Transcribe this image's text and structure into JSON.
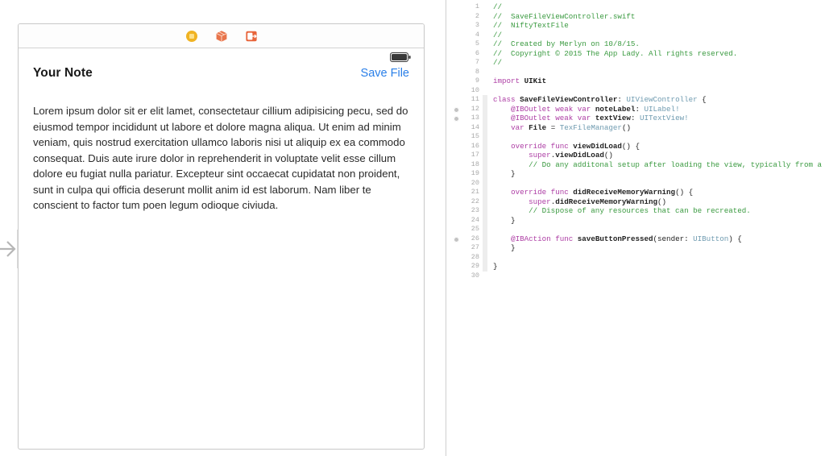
{
  "simulator": {
    "toolbar": {
      "icons": [
        {
          "name": "stop-recording-icon",
          "label": "Stop",
          "color": "#f0b323"
        },
        {
          "name": "package-cube-icon",
          "label": "Package",
          "color": "#e8744b"
        },
        {
          "name": "export-share-icon",
          "label": "Export",
          "color": "#e8643a"
        }
      ]
    },
    "status_bar": {
      "battery_icon": "battery-full-icon"
    },
    "header": {
      "title": "Your Note",
      "save_label": "Save File",
      "save_color": "#2a7fe8"
    },
    "note_body": "Lorem ipsum dolor sit er elit lamet, consectetaur cillium adipisicing pecu, sed do eiusmod tempor incididunt ut labore et dolore magna aliqua. Ut enim ad minim veniam, quis nostrud exercitation ullamco laboris nisi ut aliquip ex ea commodo consequat. Duis aute irure dolor in reprehenderit in voluptate velit esse cillum dolore eu fugiat nulla pariatur. Excepteur sint occaecat cupidatat non proident, sunt in culpa qui officia deserunt mollit anim id est laborum. Nam liber te conscient to factor tum poen legum odioque civiuda."
  },
  "navigation": {
    "back_arrow_icon": "arrow-right-icon"
  },
  "editor": {
    "filename": "SaveFileViewController.swift",
    "total_lines": 30,
    "breakpoint_lines": [
      12,
      13,
      26
    ],
    "lines": [
      {
        "n": 1,
        "tokens": [
          {
            "t": "cmt",
            "s": "//"
          }
        ]
      },
      {
        "n": 2,
        "tokens": [
          {
            "t": "cmt",
            "s": "//  SaveFileViewController.swift"
          }
        ]
      },
      {
        "n": 3,
        "tokens": [
          {
            "t": "cmt",
            "s": "//  NiftyTextFile"
          }
        ]
      },
      {
        "n": 4,
        "tokens": [
          {
            "t": "cmt",
            "s": "//"
          }
        ]
      },
      {
        "n": 5,
        "tokens": [
          {
            "t": "cmt",
            "s": "//  Created by Merlyn on 10/8/15."
          }
        ]
      },
      {
        "n": 6,
        "tokens": [
          {
            "t": "cmt",
            "s": "//  Copyright © 2015 The App Lady. All rights reserved."
          }
        ]
      },
      {
        "n": 7,
        "tokens": [
          {
            "t": "cmt",
            "s": "//"
          }
        ]
      },
      {
        "n": 8,
        "tokens": []
      },
      {
        "n": 9,
        "tokens": [
          {
            "t": "kw",
            "s": "import"
          },
          {
            "t": "id",
            "s": " UIKit"
          }
        ]
      },
      {
        "n": 10,
        "tokens": []
      },
      {
        "n": 11,
        "tokens": [
          {
            "t": "kw",
            "s": "class"
          },
          {
            "t": "id",
            "s": " SaveFileViewController"
          },
          {
            "t": "pln",
            "s": ": "
          },
          {
            "t": "type",
            "s": "UIViewController"
          },
          {
            "t": "pln",
            "s": " {"
          }
        ]
      },
      {
        "n": 12,
        "tokens": [
          {
            "t": "pln",
            "s": "    "
          },
          {
            "t": "attr",
            "s": "@IBOutlet"
          },
          {
            "t": "kw",
            "s": " weak var"
          },
          {
            "t": "id",
            "s": " noteLabel"
          },
          {
            "t": "pln",
            "s": ": "
          },
          {
            "t": "type",
            "s": "UILabel!"
          }
        ]
      },
      {
        "n": 13,
        "tokens": [
          {
            "t": "pln",
            "s": "    "
          },
          {
            "t": "attr",
            "s": "@IBOutlet"
          },
          {
            "t": "kw",
            "s": " weak var"
          },
          {
            "t": "id",
            "s": " textView"
          },
          {
            "t": "pln",
            "s": ": "
          },
          {
            "t": "type",
            "s": "UITextView!"
          }
        ]
      },
      {
        "n": 14,
        "tokens": [
          {
            "t": "pln",
            "s": "    "
          },
          {
            "t": "kw",
            "s": "var"
          },
          {
            "t": "id",
            "s": " File"
          },
          {
            "t": "pln",
            "s": " = "
          },
          {
            "t": "type",
            "s": "TexFileManager"
          },
          {
            "t": "pln",
            "s": "()"
          }
        ]
      },
      {
        "n": 15,
        "tokens": []
      },
      {
        "n": 16,
        "tokens": [
          {
            "t": "pln",
            "s": "    "
          },
          {
            "t": "kw",
            "s": "override func"
          },
          {
            "t": "id",
            "s": " viewDidLoad"
          },
          {
            "t": "pln",
            "s": "() {"
          }
        ]
      },
      {
        "n": 17,
        "tokens": [
          {
            "t": "pln",
            "s": "        "
          },
          {
            "t": "kw",
            "s": "super"
          },
          {
            "t": "pln",
            "s": "."
          },
          {
            "t": "id",
            "s": "viewDidLoad"
          },
          {
            "t": "pln",
            "s": "()"
          }
        ]
      },
      {
        "n": 18,
        "tokens": [
          {
            "t": "pln",
            "s": "        "
          },
          {
            "t": "cmt",
            "s": "// Do any additonal setup after loading the view, typically from a nib."
          }
        ]
      },
      {
        "n": 19,
        "tokens": [
          {
            "t": "pln",
            "s": "    }"
          }
        ]
      },
      {
        "n": 20,
        "tokens": []
      },
      {
        "n": 21,
        "tokens": [
          {
            "t": "pln",
            "s": "    "
          },
          {
            "t": "kw",
            "s": "override func"
          },
          {
            "t": "id",
            "s": " didReceiveMemoryWarning"
          },
          {
            "t": "pln",
            "s": "() {"
          }
        ]
      },
      {
        "n": 22,
        "tokens": [
          {
            "t": "pln",
            "s": "        "
          },
          {
            "t": "kw",
            "s": "super"
          },
          {
            "t": "pln",
            "s": "."
          },
          {
            "t": "id",
            "s": "didReceiveMemoryWarning"
          },
          {
            "t": "pln",
            "s": "()"
          }
        ]
      },
      {
        "n": 23,
        "tokens": [
          {
            "t": "pln",
            "s": "        "
          },
          {
            "t": "cmt",
            "s": "// Dispose of any resources that can be recreated."
          }
        ]
      },
      {
        "n": 24,
        "tokens": [
          {
            "t": "pln",
            "s": "    }"
          }
        ]
      },
      {
        "n": 25,
        "tokens": []
      },
      {
        "n": 26,
        "tokens": [
          {
            "t": "pln",
            "s": "    "
          },
          {
            "t": "attr",
            "s": "@IBAction"
          },
          {
            "t": "kw",
            "s": " func"
          },
          {
            "t": "id",
            "s": " saveButtonPressed"
          },
          {
            "t": "pln",
            "s": "(sender: "
          },
          {
            "t": "type",
            "s": "UIButton"
          },
          {
            "t": "pln",
            "s": ") {"
          }
        ]
      },
      {
        "n": 27,
        "tokens": [
          {
            "t": "pln",
            "s": "    }"
          }
        ]
      },
      {
        "n": 28,
        "tokens": []
      },
      {
        "n": 29,
        "tokens": [
          {
            "t": "pln",
            "s": "}"
          }
        ]
      },
      {
        "n": 30,
        "tokens": []
      }
    ],
    "fold_bands": [
      {
        "from": 11,
        "to": 29
      },
      {
        "from": 16,
        "to": 19
      },
      {
        "from": 21,
        "to": 24
      },
      {
        "from": 26,
        "to": 27
      }
    ]
  }
}
